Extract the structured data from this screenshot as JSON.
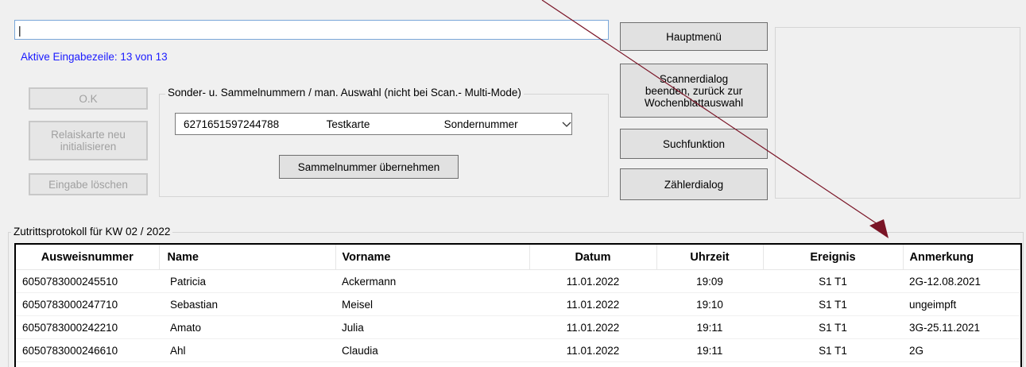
{
  "input": {
    "value": "|",
    "placeholder": ""
  },
  "status_line": "Aktive Eingabezeile: 13 von 13",
  "left_buttons": {
    "ok": "O.K",
    "relais": "Relaiskarte  neu\ninitialisieren",
    "clear": "Eingabe löschen"
  },
  "group": {
    "label": "Sonder- u.  Sammelnummern / man.  Auswahl (nicht bei Scan.- Multi-Mode)",
    "combo": {
      "number": "6271651597244788",
      "name": "Testkarte",
      "type": "Sondernummer"
    },
    "apply_button": "Sammelnummer übernehmen"
  },
  "right_buttons": {
    "main_menu": "Hauptmenü",
    "scanner": "Scannerdialog\nbeenden, zurück zur\nWochenblattauswahl",
    "search": "Suchfunktion",
    "counter": "Zählerdialog"
  },
  "protocol": {
    "label": "Zutrittsprotokoll für KW 02 / 2022",
    "columns": [
      "Ausweisnummer",
      "Name",
      "Vorname",
      "Datum",
      "Uhrzeit",
      "Ereignis",
      "Anmerkung"
    ],
    "rows": [
      [
        "6050783000245510",
        "Patricia",
        "Ackermann",
        "11.01.2022",
        "19:09",
        "S1 T1",
        "2G-12.08.2021"
      ],
      [
        "6050783000247710",
        "Sebastian",
        "Meisel",
        "11.01.2022",
        "19:10",
        "S1 T1",
        "ungeimpft"
      ],
      [
        "6050783000242210",
        "Amato",
        "Julia",
        "11.01.2022",
        "19:11",
        "S1 T1",
        "3G-25.11.2021"
      ],
      [
        "6050783000246610",
        "Ahl",
        "Claudia",
        "11.01.2022",
        "19:11",
        "S1 T1",
        "2G"
      ]
    ]
  },
  "colors": {
    "status_text": "#1a1aff",
    "annotation_arrow": "#7a1426"
  }
}
